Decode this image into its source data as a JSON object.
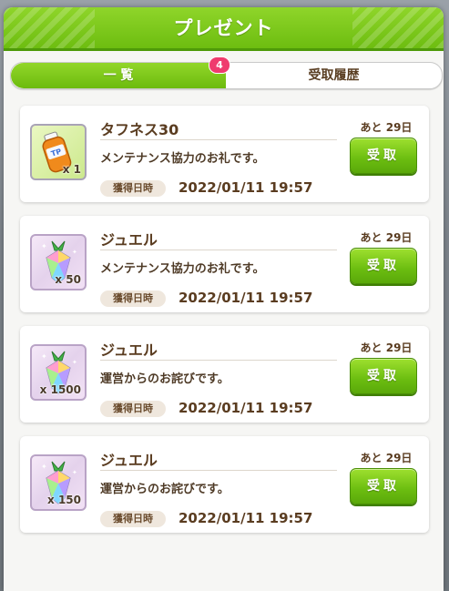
{
  "dialog": {
    "title": "プレゼント"
  },
  "tabs": [
    {
      "label": "一 覧",
      "active": true,
      "badge": "4"
    },
    {
      "label": "受取履歴",
      "active": false
    }
  ],
  "items": [
    {
      "name": "タフネス30",
      "icon": "tp-bottle-icon",
      "quantity": "x 1",
      "message": "メンテナンス協力のお礼です。",
      "date_label": "獲得日時",
      "date": "2022/01/11 19:57",
      "remaining": "あと 29日",
      "button": "受取"
    },
    {
      "name": "ジュエル",
      "icon": "jewel-icon",
      "quantity": "x 50",
      "message": "メンテナンス協力のお礼です。",
      "date_label": "獲得日時",
      "date": "2022/01/11 19:57",
      "remaining": "あと 29日",
      "button": "受取"
    },
    {
      "name": "ジュエル",
      "icon": "jewel-icon",
      "quantity": "x 1500",
      "message": "運営からのお詫びです。",
      "date_label": "獲得日時",
      "date": "2022/01/11 19:57",
      "remaining": "あと 29日",
      "button": "受取"
    },
    {
      "name": "ジュエル",
      "icon": "jewel-icon",
      "quantity": "x 150",
      "message": "運営からのお詫びです。",
      "date_label": "獲得日時",
      "date": "2022/01/11 19:57",
      "remaining": "あと 29日",
      "button": "受取"
    }
  ],
  "colors": {
    "accent_green": "#6dbd10",
    "badge_pink": "#ef3b6e",
    "text_brown": "#5a3c20"
  }
}
